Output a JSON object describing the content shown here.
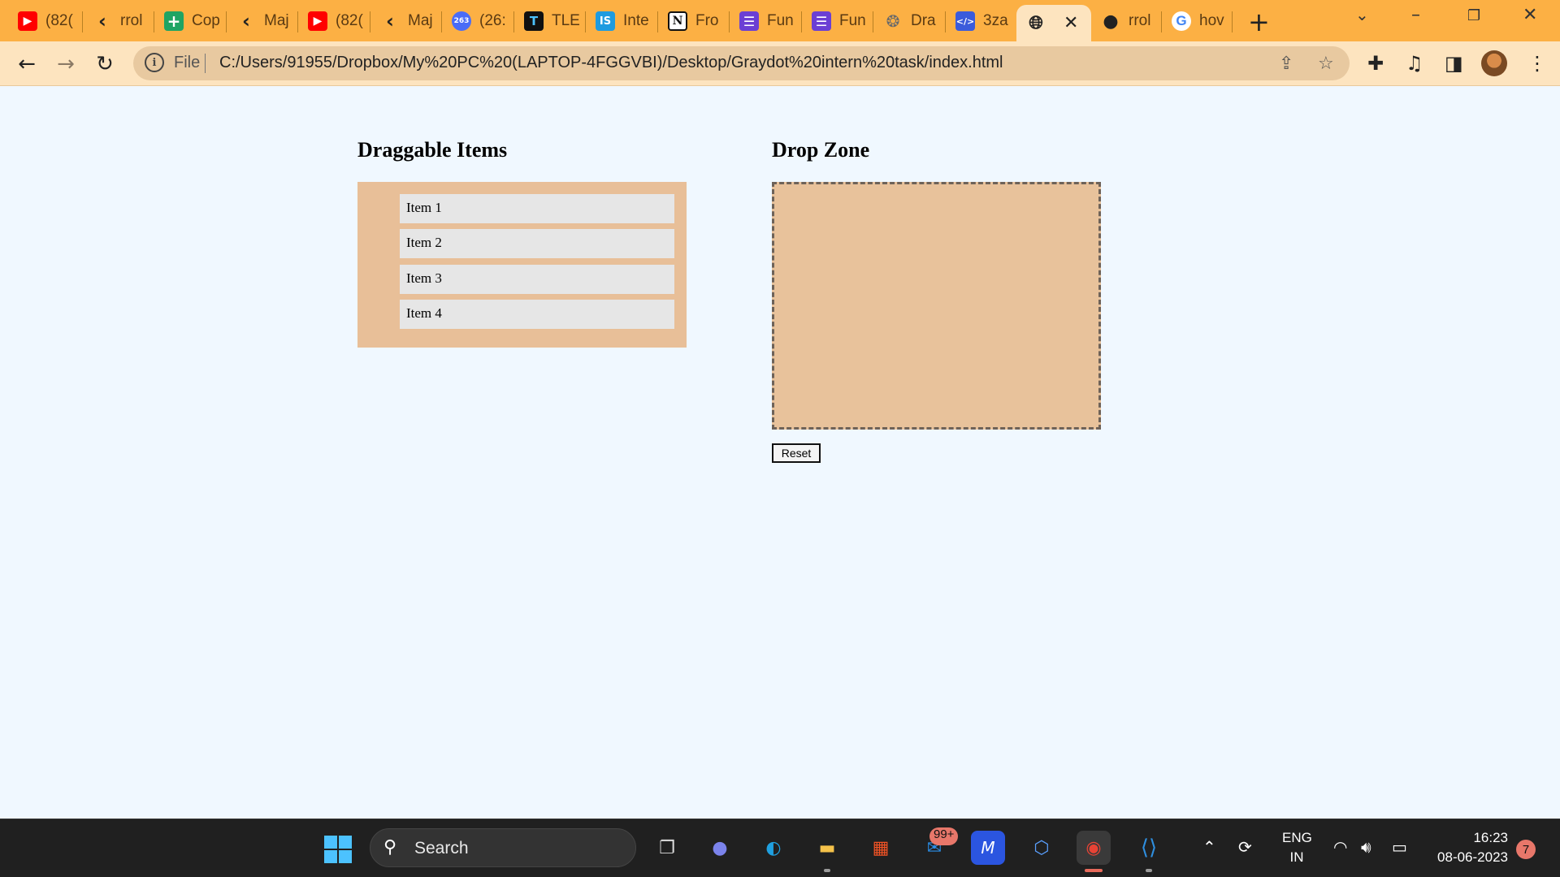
{
  "browser": {
    "tabs": [
      {
        "label": "(82(",
        "icon": "youtube-icon",
        "color": "#ff0000"
      },
      {
        "label": "rrol",
        "icon": "back-arrow-icon",
        "color": "#333333"
      },
      {
        "label": "Cop",
        "icon": "sheets-icon",
        "color": "#1fa463"
      },
      {
        "label": "Maj",
        "icon": "back-arrow-icon",
        "color": "#333333"
      },
      {
        "label": "(82(",
        "icon": "youtube-icon",
        "color": "#ff0000"
      },
      {
        "label": "Maj",
        "icon": "back-arrow-icon",
        "color": "#333333"
      },
      {
        "label": "(26:",
        "icon": "badge-263-icon",
        "color": "#4a6cf7"
      },
      {
        "label": "TLE",
        "icon": "tle-icon",
        "color": "#111111"
      },
      {
        "label": "Inte",
        "icon": "is-icon",
        "color": "#1e9be0"
      },
      {
        "label": "Fro",
        "icon": "notion-icon",
        "color": "#111111"
      },
      {
        "label": "Fun",
        "icon": "list-icon",
        "color": "#6b3fd4"
      },
      {
        "label": "Fun",
        "icon": "list-icon",
        "color": "#6b3fd4"
      },
      {
        "label": "Dra",
        "icon": "openai-icon",
        "color": "#7a7a7a"
      },
      {
        "label": "3za",
        "icon": "code-icon",
        "color": "#3b5bdb"
      }
    ],
    "active_tab_icon": "globe-icon",
    "tabs_after": [
      {
        "label": "rrol",
        "icon": "github-icon",
        "color": "#333333"
      },
      {
        "label": "hov",
        "icon": "google-icon",
        "color": "#4285f4"
      }
    ],
    "new_tab_symbol": "+",
    "file_label": "File",
    "url": "C:/Users/91955/Dropbox/My%20PC%20(LAPTOP-4FGGVBI)/Desktop/Graydot%20intern%20task/index.html",
    "accent_color": "#fcb044"
  },
  "page": {
    "draggable_heading": "Draggable Items",
    "drop_heading": "Drop Zone",
    "items": [
      "Item 1",
      "Item 2",
      "Item 3",
      "Item 4"
    ],
    "reset_label": "Reset"
  },
  "taskbar": {
    "search_label": "Search",
    "mail_badge": "99+",
    "language": "ENG",
    "region": "IN",
    "time": "16:23",
    "date": "08-06-2023",
    "notification_count": "7"
  }
}
